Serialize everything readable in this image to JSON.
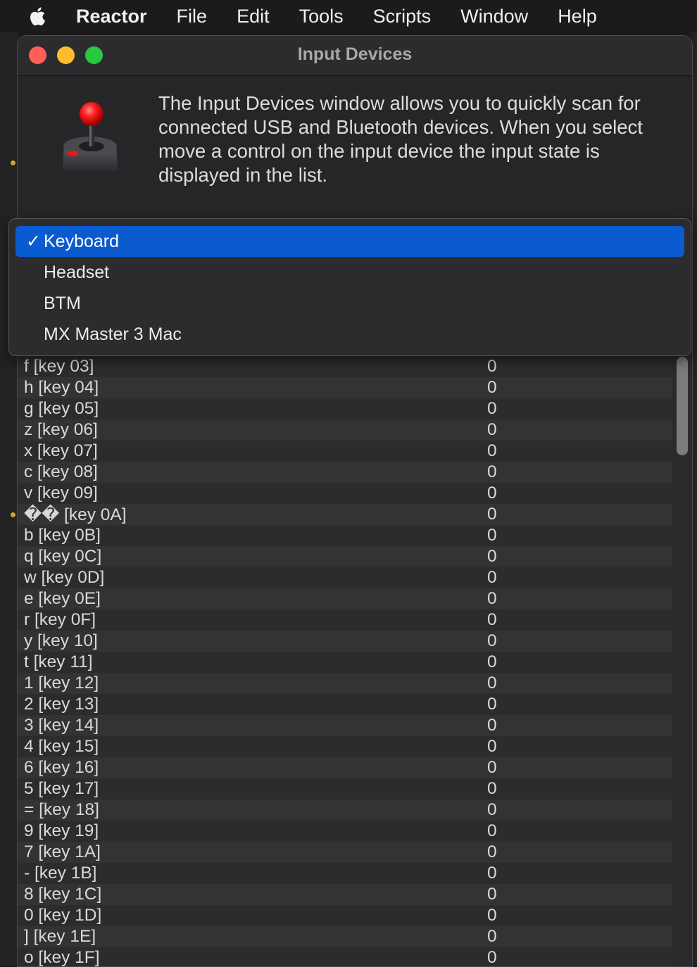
{
  "menubar": {
    "app": "Reactor",
    "items": [
      "File",
      "Edit",
      "Tools",
      "Scripts",
      "Window",
      "Help"
    ]
  },
  "window": {
    "title": "Input Devices",
    "description": "The Input Devices window allows you to quickly scan for connected USB and Bluetooth devices. When you select move a control on the input device the input state is displayed in the list."
  },
  "device_menu": {
    "check": "✓",
    "options": [
      {
        "label": "Keyboard",
        "selected": true
      },
      {
        "label": "Headset",
        "selected": false
      },
      {
        "label": "BTM",
        "selected": false
      },
      {
        "label": "MX Master 3 Mac",
        "selected": false
      }
    ]
  },
  "inputs": {
    "rows": [
      {
        "name": "f [key 03]",
        "value": "0"
      },
      {
        "name": "h [key 04]",
        "value": "0"
      },
      {
        "name": "g [key 05]",
        "value": "0"
      },
      {
        "name": "z [key 06]",
        "value": "0"
      },
      {
        "name": "x [key 07]",
        "value": "0"
      },
      {
        "name": "c [key 08]",
        "value": "0"
      },
      {
        "name": "v [key 09]",
        "value": "0"
      },
      {
        "name": "�� [key 0A]",
        "value": "0"
      },
      {
        "name": "b [key 0B]",
        "value": "0"
      },
      {
        "name": "q [key 0C]",
        "value": "0"
      },
      {
        "name": "w [key 0D]",
        "value": "0"
      },
      {
        "name": "e [key 0E]",
        "value": "0"
      },
      {
        "name": "r [key 0F]",
        "value": "0"
      },
      {
        "name": "y [key 10]",
        "value": "0"
      },
      {
        "name": "t [key 11]",
        "value": "0"
      },
      {
        "name": "1 [key 12]",
        "value": "0"
      },
      {
        "name": "2 [key 13]",
        "value": "0"
      },
      {
        "name": "3 [key 14]",
        "value": "0"
      },
      {
        "name": "4 [key 15]",
        "value": "0"
      },
      {
        "name": "6 [key 16]",
        "value": "0"
      },
      {
        "name": "5 [key 17]",
        "value": "0"
      },
      {
        "name": "= [key 18]",
        "value": "0"
      },
      {
        "name": "9 [key 19]",
        "value": "0"
      },
      {
        "name": "7 [key 1A]",
        "value": "0"
      },
      {
        "name": "- [key 1B]",
        "value": "0"
      },
      {
        "name": "8 [key 1C]",
        "value": "0"
      },
      {
        "name": "0 [key 1D]",
        "value": "0"
      },
      {
        "name": "] [key 1E]",
        "value": "0"
      },
      {
        "name": "o [key 1F]",
        "value": "0"
      }
    ]
  },
  "icons": {
    "apple": "apple-logo-icon",
    "device": "joystick-icon"
  },
  "colors": {
    "selection": "#0a5bd0",
    "close": "#fe5f57",
    "minimize": "#febc2e",
    "maximize": "#28c840"
  }
}
